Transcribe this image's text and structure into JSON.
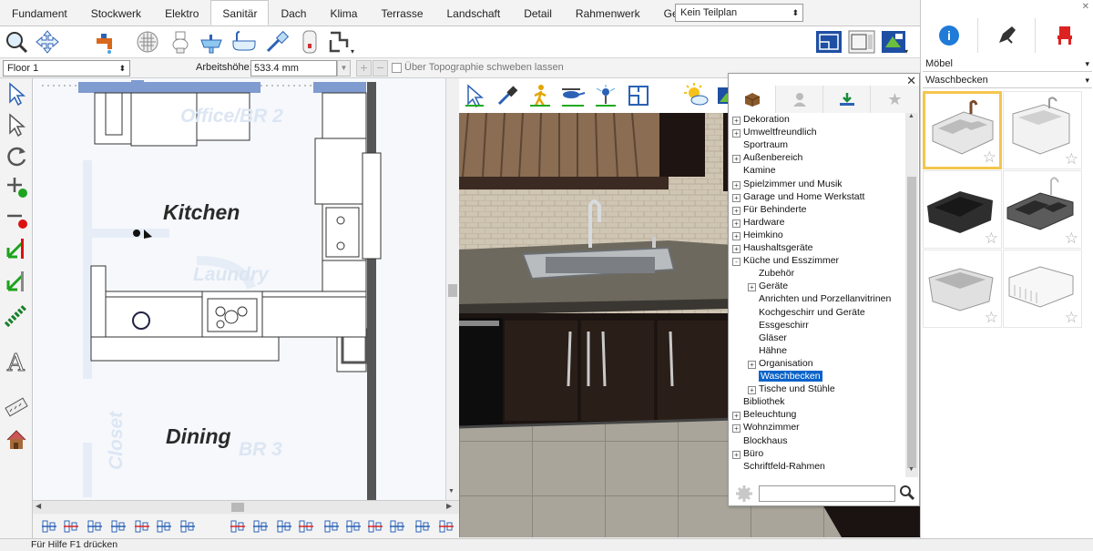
{
  "tabs": [
    "Fundament",
    "Stockwerk",
    "Elektro",
    "Sanitär",
    "Dach",
    "Klima",
    "Terrasse",
    "Landschaft",
    "Detail",
    "Rahmenwerk",
    "Gelände"
  ],
  "active_tab": "Sanitär",
  "plan_select": "Kein Teilplan",
  "floor_select": "Floor 1",
  "arbeitshoehe_label": "Arbeitshöhe:",
  "arbeitshoehe_value": "533.4 mm",
  "topo_label": "Über Topographie schweben lassen",
  "plan_labels": {
    "kitchen": "Kitchen",
    "dining": "Dining",
    "office": "Office/BR 2",
    "laundry": "Laundry",
    "closet": "Closet",
    "br3": "BR 3"
  },
  "tree": [
    {
      "label": "Dekoration",
      "level": 0,
      "exp": "+"
    },
    {
      "label": "Umweltfreundlich",
      "level": 0,
      "exp": "+"
    },
    {
      "label": "Sportraum",
      "level": 0,
      "exp": ""
    },
    {
      "label": "Außenbereich",
      "level": 0,
      "exp": "+"
    },
    {
      "label": "Kamine",
      "level": 0,
      "exp": ""
    },
    {
      "label": "Spielzimmer und Musik",
      "level": 0,
      "exp": "+"
    },
    {
      "label": "Garage und Home Werkstatt",
      "level": 0,
      "exp": "+"
    },
    {
      "label": "Für Behinderte",
      "level": 0,
      "exp": "+"
    },
    {
      "label": "Hardware",
      "level": 0,
      "exp": "+"
    },
    {
      "label": "Heimkino",
      "level": 0,
      "exp": "+"
    },
    {
      "label": "Haushaltsgeräte",
      "level": 0,
      "exp": "+"
    },
    {
      "label": "Küche und Esszimmer",
      "level": 0,
      "exp": "-"
    },
    {
      "label": "Zubehör",
      "level": 1,
      "exp": ""
    },
    {
      "label": "Geräte",
      "level": 1,
      "exp": "+"
    },
    {
      "label": "Anrichten und Porzellanvitrinen",
      "level": 1,
      "exp": ""
    },
    {
      "label": "Kochgeschirr und Geräte",
      "level": 1,
      "exp": ""
    },
    {
      "label": "Essgeschirr",
      "level": 1,
      "exp": ""
    },
    {
      "label": "Gläser",
      "level": 1,
      "exp": ""
    },
    {
      "label": "Hähne",
      "level": 1,
      "exp": ""
    },
    {
      "label": "Organisation",
      "level": 1,
      "exp": "+"
    },
    {
      "label": "Waschbecken",
      "level": 1,
      "exp": "",
      "selected": true
    },
    {
      "label": "Tische und Stühle",
      "level": 1,
      "exp": "+"
    },
    {
      "label": "Bibliothek",
      "level": 0,
      "exp": ""
    },
    {
      "label": "Beleuchtung",
      "level": 0,
      "exp": "+"
    },
    {
      "label": "Wohnzimmer",
      "level": 0,
      "exp": "+"
    },
    {
      "label": "Blockhaus",
      "level": 0,
      "exp": ""
    },
    {
      "label": "Büro",
      "level": 0,
      "exp": "+"
    },
    {
      "label": "Schriftfeld-Rahmen",
      "level": 0,
      "exp": ""
    }
  ],
  "catalog": {
    "category": "Möbel",
    "subcategory": "Waschbecken"
  },
  "status": "Für Hilfe F1 drücken",
  "colors": {
    "accent_blue": "#0a63c9",
    "selection_border": "#f4c64d",
    "wall_blue": "#7f9bd0"
  }
}
